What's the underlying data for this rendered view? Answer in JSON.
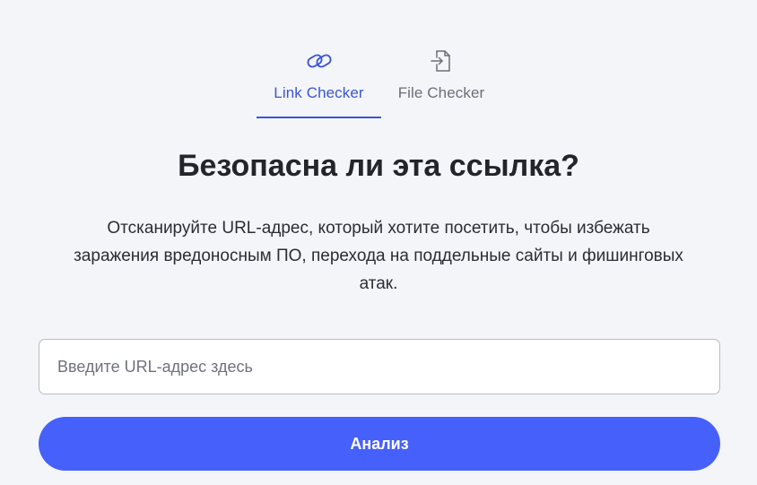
{
  "tabs": [
    {
      "label": "Link Checker",
      "icon": "link-icon",
      "active": true
    },
    {
      "label": "File Checker",
      "icon": "file-import-icon",
      "active": false
    }
  ],
  "heading": "Безопасна ли эта ссылка?",
  "description": "Отсканируйте URL-адрес, который хотите посетить, чтобы избежать заражения вредоносным ПО, перехода на поддельные сайты и фишинговых атак.",
  "url_input": {
    "placeholder": "Введите URL-адрес здесь",
    "value": ""
  },
  "analyze_button": "Анализ",
  "colors": {
    "accent": "#3a55d6",
    "button": "#4660fb",
    "background": "#f4f5f9",
    "inactive_tab": "#6b6e78"
  }
}
